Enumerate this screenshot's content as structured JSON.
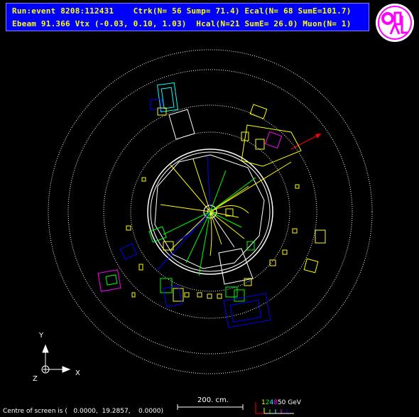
{
  "header": {
    "line1": "Run:event 8208:112431    Ctrk(N= 56 Sump= 71.4) Ecal(N= 68 SumE=101.7)",
    "line2": "Ebeam 91.366 Vtx (-0.03, 0.10, 1.03)  Hcal(N=21 SumE= 26.0) Muon(N= 1)"
  },
  "logo": {
    "text": "OPAL",
    "color": "#ff00ff"
  },
  "axes": {
    "y": "Y",
    "x": "X",
    "z": "Z"
  },
  "scale": {
    "label": "200. cm."
  },
  "legend": {
    "values": [
      "1",
      "2",
      "4",
      "8",
      "50"
    ],
    "unit": "GeV",
    "colors": [
      "#ff0000",
      "#ffff00",
      "#00ff00",
      "#00ffff",
      "#ff00ff"
    ]
  },
  "footer": {
    "text": "Centre of screen is (   0.0000,  19.2857,    0.0000)"
  },
  "colors": {
    "background": "#000000",
    "header_bg": "#0000ff",
    "header_text": "#ffff00",
    "track_yellow": "#ffff00",
    "track_green": "#00ff00",
    "track_blue": "#0000ff",
    "ecal_yellow": "#ffff00",
    "hcal_magenta": "#ff00ff",
    "muon_red": "#ff0000"
  }
}
